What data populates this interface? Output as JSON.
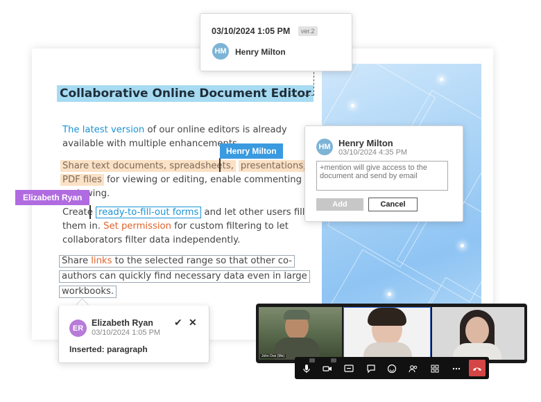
{
  "version_popup": {
    "datetime": "03/10/2024 1:05 PM",
    "version": "ver.2",
    "initials": "HM",
    "user": "Henry Milton"
  },
  "document": {
    "title": "Collaborative Online Document Editor",
    "p1": {
      "link": "The latest version",
      "line1_rest": " of our online editors is already",
      "line2": "available with multiple enhancements"
    },
    "p2": {
      "hl1": "Share text documents, spreadsheets,",
      "hl2": "presentations, and",
      "hl3": "PDF files",
      "line2_rest": " for viewing  or editing, enable commenting or",
      "line3": "reviewing."
    },
    "p3": {
      "create": "Create ",
      "boxed": "ready-to-fill-out forms",
      "line1_rest": " and let other users fill",
      "line2_start": "them in. ",
      "set_permission": "Set permission",
      "line2_rest": " for custom filtering to let",
      "line3": "collaborators filter data independently."
    },
    "p4": {
      "share": "Share ",
      "links": "links",
      "line1_rest": " to the selected range so that other co-",
      "line2": "authors can quickly find necessary data even in large",
      "line3": "workbooks."
    }
  },
  "cursors": {
    "henry": "Henry Milton",
    "elizabeth": "Elizabeth Ryan"
  },
  "comment": {
    "initials": "HM",
    "user": "Henry Milton",
    "datetime": "03/10/2024  4:35 PM",
    "placeholder": "+mention will give access to the document and send by email",
    "add_label": "Add",
    "cancel_label": "Cancel"
  },
  "review": {
    "initials": "ER",
    "user": "Elizabeth Ryan",
    "datetime": "03/10/2024 1:05 PM",
    "change": "Inserted: paragraph",
    "accept_glyph": "✔",
    "reject_glyph": "✕"
  },
  "video": {
    "participant_label": "John Doe (Me)"
  },
  "colors": {
    "henry_tag": "#3a9ae0",
    "elizabeth_tag": "#b06be0",
    "title_highlight": "#a6dbf2",
    "end_call": "#d64545"
  }
}
